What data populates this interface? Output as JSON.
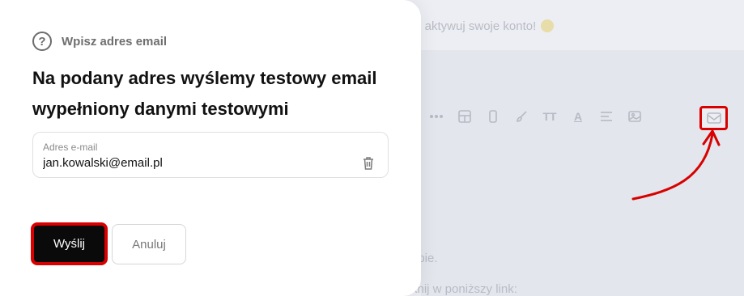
{
  "background": {
    "title_text": "ę, aktywuj swoje konto!",
    "line1": "epie.",
    "line2": "knij w poniższy link:",
    "toolbar": [
      {
        "icon": "more-icon"
      },
      {
        "icon": "table-icon"
      },
      {
        "icon": "mobile-icon"
      },
      {
        "icon": "brush-icon"
      },
      {
        "icon": "text-size-icon",
        "label": "TT"
      },
      {
        "icon": "text-color-icon",
        "label": "A"
      },
      {
        "icon": "align-icon"
      },
      {
        "icon": "image-icon"
      }
    ],
    "highlight_icon": "mail-icon",
    "highlight_color": "#d80000"
  },
  "modal": {
    "help_label": "Wpisz adres email",
    "heading": "Na podany adres wyślemy testowy email wypełniony danymi testowymi",
    "email_field": {
      "label": "Adres e-mail",
      "value": "jan.kowalski@email.pl"
    },
    "send_label": "Wyślij",
    "cancel_label": "Anuluj"
  }
}
